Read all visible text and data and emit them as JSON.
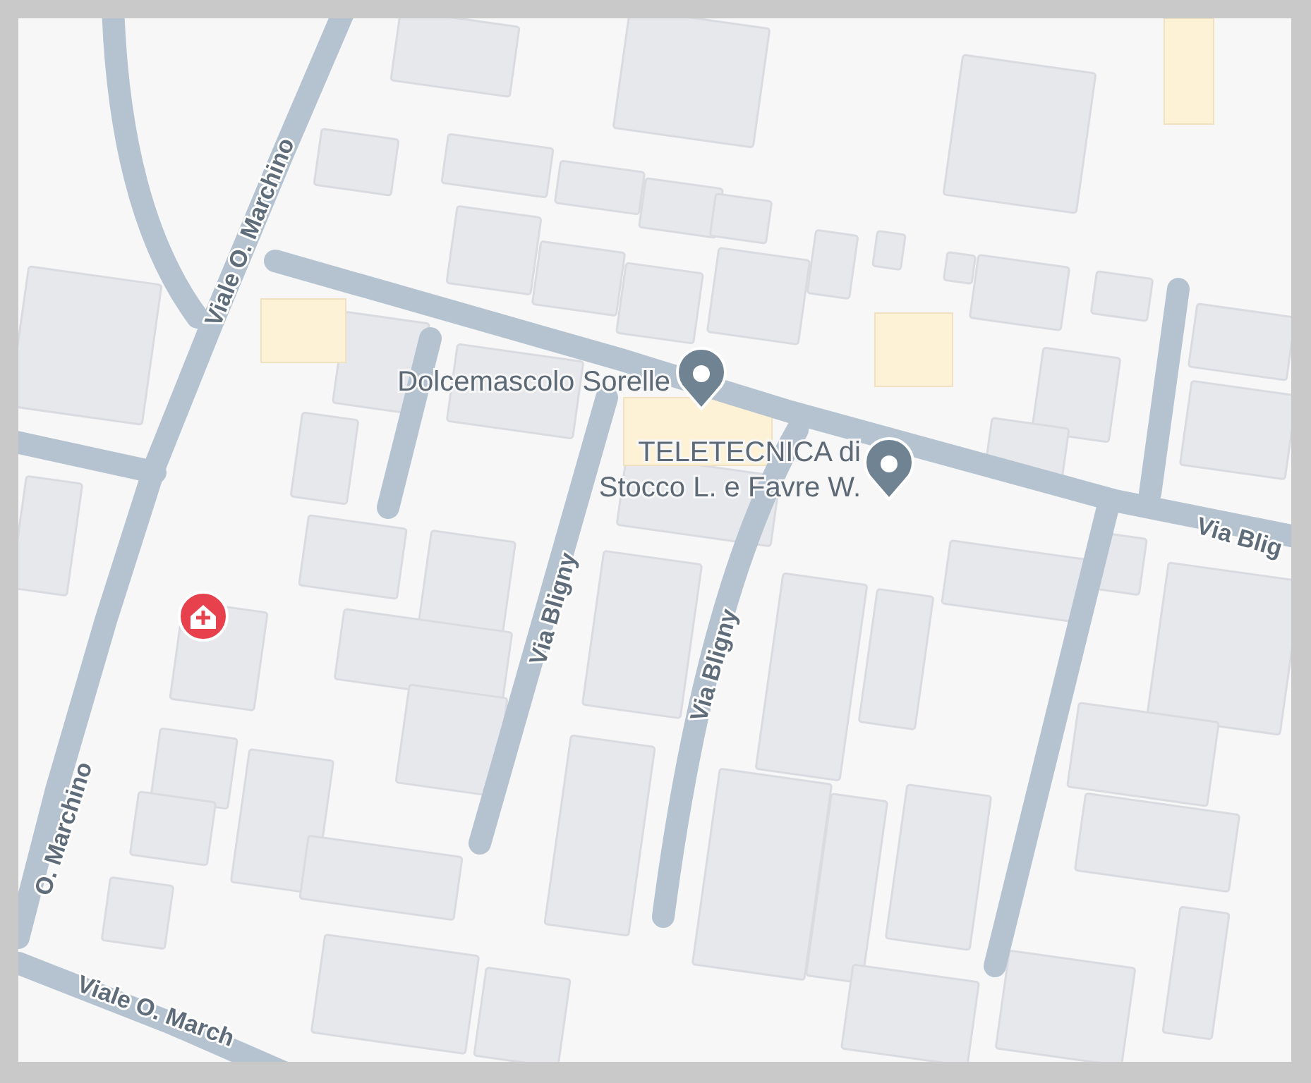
{
  "map": {
    "street_labels": [
      {
        "text": "Viale O. Marchino"
      },
      {
        "text": "O. Marchino"
      },
      {
        "text": "Viale O. March"
      },
      {
        "text": "Via Bligny"
      },
      {
        "text": "Via Bligny"
      },
      {
        "text": "Via Blig"
      }
    ],
    "places": [
      {
        "label_lines": [
          "Dolcemascolo Sorelle"
        ]
      },
      {
        "label_lines": [
          "TELETECNICA di",
          "Stocco L. e Favre W."
        ]
      }
    ]
  }
}
